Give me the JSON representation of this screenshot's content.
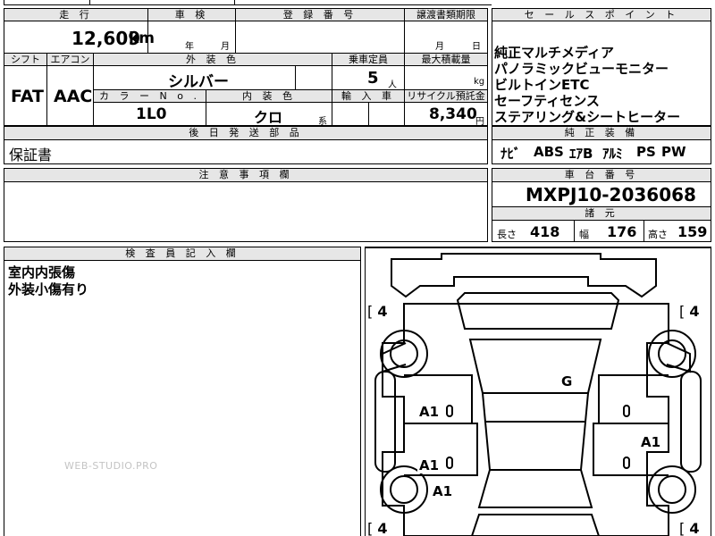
{
  "labels": {
    "mileage": "走 行",
    "inspection": "車 検",
    "registration": "登 録 番 号",
    "transfer_deadline": "譲渡書類期限",
    "sales_points": "セ ー ル ス ポ イ ン ト",
    "shift": "シフト",
    "aircon": "エアコン",
    "exterior_color": "外 装 色",
    "capacity": "乗車定員",
    "max_load": "最大積載量",
    "color_no": "カ ラ ー N o .",
    "interior_color": "内 装 色",
    "import": "輸 入 車",
    "recycle": "リサイクル預託金",
    "later_parts": "後 日 発 送 部 品",
    "standard_equipment": "純 正 装 備",
    "notes": "注 意 事 項 欄",
    "chassis_no": "車 台 番 号",
    "specs": "諸 元",
    "inspector": "検 査 員 記 入 欄"
  },
  "units": {
    "km": "km",
    "year": "年",
    "month": "月",
    "day": "日",
    "person": "人",
    "kg": "kg",
    "yen": "円",
    "series": "系"
  },
  "vehicle": {
    "mileage": "12,609",
    "shift": "FAT",
    "aircon": "AAC",
    "exterior_color": "シルバー",
    "capacity": "5",
    "color_no": "1L0",
    "interior_color": "クロ",
    "recycle_fee": "8,340",
    "later_parts": "保証書",
    "chassis_no": "MXPJ10-2036068"
  },
  "sales_points": [
    "純正マルチメディア",
    "パノラミックビューモニター",
    "ビルトインETC",
    "セーフティセンス",
    "ステアリング&シートヒーター"
  ],
  "equipment": [
    "ﾅﾋﾞ",
    "ABS",
    "ｴｱB",
    "ｱﾙﾐ",
    "PS",
    "PW"
  ],
  "specs": {
    "length_label": "長さ",
    "length": "418",
    "width_label": "幅",
    "width": "176",
    "height_label": "高さ",
    "height": "159"
  },
  "inspector_notes": [
    "室内内張傷",
    "外装小傷有り"
  ],
  "diagram": {
    "tire_tl": "4",
    "tire_tr": "4",
    "tire_bl": "4",
    "tire_br": "4",
    "mark_g": "G",
    "mark_a1_left_front": "A1",
    "mark_a1_right": "A1",
    "mark_a1_left_rear": "A1",
    "mark_a1_left_low": "A1"
  },
  "watermark": "WEB-STUDIO.PRO"
}
